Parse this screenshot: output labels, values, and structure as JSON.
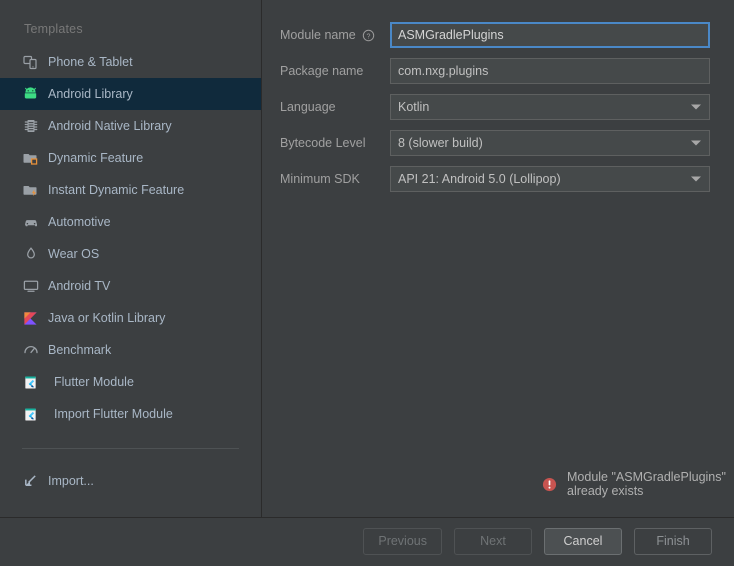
{
  "sidebar": {
    "header": "Templates",
    "items": [
      {
        "label": "Phone & Tablet",
        "icon": "phone-tablet-icon",
        "selected": false,
        "indented": false
      },
      {
        "label": "Android Library",
        "icon": "android-robot-icon",
        "selected": true,
        "indented": false
      },
      {
        "label": "Android Native Library",
        "icon": "native-chip-icon",
        "selected": false,
        "indented": false
      },
      {
        "label": "Dynamic Feature",
        "icon": "folder-dynamic-icon",
        "selected": false,
        "indented": false
      },
      {
        "label": "Instant Dynamic Feature",
        "icon": "folder-instant-icon",
        "selected": false,
        "indented": false
      },
      {
        "label": "Automotive",
        "icon": "car-icon",
        "selected": false,
        "indented": false
      },
      {
        "label": "Wear OS",
        "icon": "watch-icon",
        "selected": false,
        "indented": false
      },
      {
        "label": "Android TV",
        "icon": "tv-icon",
        "selected": false,
        "indented": false
      },
      {
        "label": "Java or Kotlin Library",
        "icon": "kotlin-icon",
        "selected": false,
        "indented": false
      },
      {
        "label": "Benchmark",
        "icon": "benchmark-gauge-icon",
        "selected": false,
        "indented": false
      },
      {
        "label": "Flutter Module",
        "icon": "flutter-module-icon",
        "selected": false,
        "indented": true
      },
      {
        "label": "Import Flutter Module",
        "icon": "flutter-module-icon",
        "selected": false,
        "indented": true
      }
    ],
    "import_label": "Import..."
  },
  "form": {
    "fields": [
      {
        "label": "Module name",
        "value": "ASMGradlePlugins",
        "type": "text",
        "focused": true
      },
      {
        "label": "Package name",
        "value": "com.nxg.plugins",
        "type": "text",
        "focused": false
      },
      {
        "label": "Language",
        "value": "Kotlin",
        "type": "combo"
      },
      {
        "label": "Bytecode Level",
        "value": "8 (slower build)",
        "type": "combo"
      },
      {
        "label": "Minimum SDK",
        "value": "API 21: Android 5.0 (Lollipop)",
        "type": "combo"
      }
    ],
    "help_tooltip_icon": "help-circle-icon"
  },
  "error": {
    "icon": "error-circle-icon",
    "message": "Module \"ASMGradlePlugins\" already exists"
  },
  "footer": {
    "buttons": [
      {
        "label": "Previous",
        "state": "disabled"
      },
      {
        "label": "Next",
        "state": "disabled"
      },
      {
        "label": "Cancel",
        "state": "hover"
      },
      {
        "label": "Finish",
        "state": "dim"
      }
    ]
  },
  "colors": {
    "background": "#3c3f41",
    "selected_row": "#102a3c",
    "focus_border": "#4a88c7",
    "error_red": "#c75450",
    "android_green": "#3ddc84",
    "text": "#a9b7c6"
  }
}
